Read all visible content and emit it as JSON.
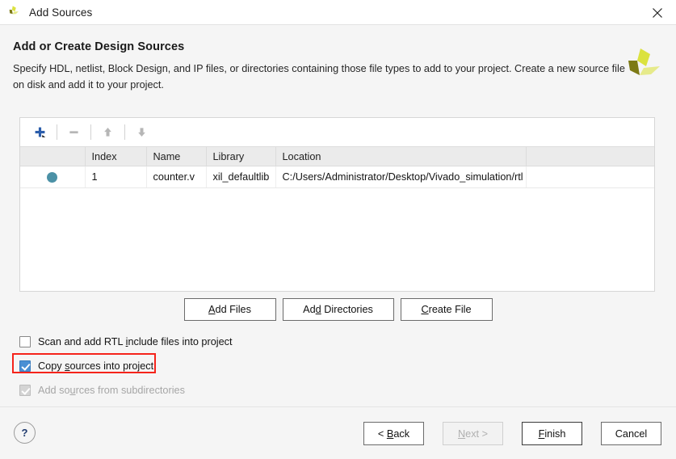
{
  "window": {
    "title": "Add Sources",
    "app_icon": "vivado-logo-icon",
    "close_icon": "close-icon"
  },
  "header": {
    "title": "Add or Create Design Sources",
    "description": "Specify HDL, netlist, Block Design, and IP files, or directories containing those file types to add to your project. Create a new source file on disk and add it to your project.",
    "brand_icon": "vivado-logo-icon"
  },
  "toolbar": {
    "add_icon": "plus-icon",
    "remove_icon": "minus-icon",
    "move_up_icon": "arrow-up-icon",
    "move_down_icon": "arrow-down-icon"
  },
  "table": {
    "columns": [
      "",
      "Index",
      "Name",
      "Library",
      "Location",
      ""
    ],
    "rows": [
      {
        "selected": true,
        "index": "1",
        "name": "counter.v",
        "library": "xil_defaultlib",
        "location": "C:/Users/Administrator/Desktop/Vivado_simulation/rtl"
      }
    ]
  },
  "mid_buttons": [
    {
      "id": "add-files",
      "pre": "A",
      "mnemonic": "",
      "label_before": "",
      "label": "Add Files",
      "accel_index": 0
    },
    {
      "id": "add-directories",
      "label": "Add Directories",
      "accel_index": 2
    },
    {
      "id": "create-file",
      "label": "Create File",
      "accel_index": 0
    }
  ],
  "options": [
    {
      "id": "scan-rtl-include",
      "label": "Scan and add RTL include files into project",
      "accel_index": 17,
      "checked": false,
      "disabled": false,
      "highlighted": false
    },
    {
      "id": "copy-sources",
      "label": "Copy sources into project",
      "accel_index": 5,
      "checked": true,
      "disabled": false,
      "highlighted": true
    },
    {
      "id": "add-subdirectories",
      "label": "Add sources from subdirectories",
      "accel_index": 6,
      "checked": true,
      "disabled": true,
      "highlighted": false
    }
  ],
  "footer": {
    "help_label": "?",
    "buttons": [
      {
        "id": "back",
        "label": "< Back",
        "accel_index": 2,
        "disabled": false,
        "default": false
      },
      {
        "id": "next",
        "label": "Next >",
        "accel_index": 0,
        "disabled": true,
        "default": false
      },
      {
        "id": "finish",
        "label": "Finish",
        "accel_index": 0,
        "disabled": false,
        "default": true
      },
      {
        "id": "cancel",
        "label": "Cancel",
        "accel_index": -1,
        "disabled": false,
        "default": false
      }
    ]
  },
  "colors": {
    "accent_blue": "#2b5dab",
    "selection_dot": "#4b91a6",
    "checkbox_checked": "#4a8fd4",
    "highlight_red": "#f5241b",
    "logo_dark": "#7d7a15",
    "logo_light": "#dbe23f",
    "logo_mid": "#e6ea8a"
  }
}
